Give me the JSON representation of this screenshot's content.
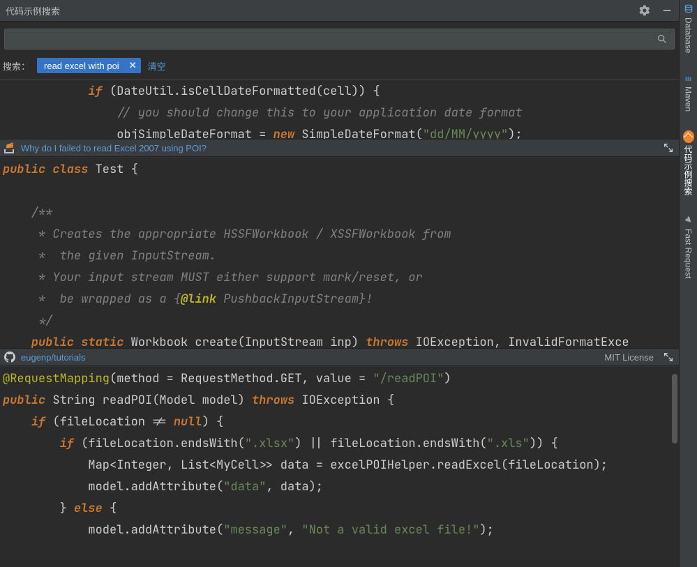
{
  "titlebar": {
    "title": "代码示例搜索"
  },
  "search": {
    "value": "",
    "placeholder": ""
  },
  "filter": {
    "label": "搜索：",
    "chip_text": "read excel with poi",
    "chip_close": "✕",
    "clear": "清空"
  },
  "sidebar": {
    "items": [
      {
        "icon": "database",
        "label": "Database"
      },
      {
        "icon": "maven",
        "label": "Maven"
      },
      {
        "icon": "code-search",
        "label": "代码示例搜索"
      },
      {
        "icon": "rocket",
        "label": "Fast Request"
      }
    ]
  },
  "result_headers": {
    "so": {
      "title": "Why do I failed to read Excel 2007 using POI?"
    },
    "gh": {
      "repo": "eugenp/tutorials",
      "license": "MIT License"
    }
  },
  "code": {
    "top": [
      {
        "indent": "            ",
        "tokens": [
          {
            "t": "if",
            "c": "kw"
          },
          {
            "t": " (DateUtil.isCellDateFormatted(cell)) {"
          }
        ]
      },
      {
        "indent": "                ",
        "tokens": [
          {
            "t": "// you should change this to your application date format",
            "c": "cm"
          }
        ]
      },
      {
        "indent": "                ",
        "tokens": [
          {
            "t": "objSimpleDateFormat = "
          },
          {
            "t": "new",
            "c": "kw"
          },
          {
            "t": " SimpleDateFormat("
          },
          {
            "t": "\"dd/MM/yyyy\"",
            "c": "st"
          },
          {
            "t": ");"
          }
        ]
      }
    ],
    "mid": [
      {
        "indent": "",
        "tokens": [
          {
            "t": "public",
            "c": "kw"
          },
          {
            "t": " "
          },
          {
            "t": "class",
            "c": "kw"
          },
          {
            "t": " Test {"
          }
        ]
      },
      {
        "indent": "",
        "tokens": [
          {
            "t": " "
          }
        ]
      },
      {
        "indent": "    ",
        "tokens": [
          {
            "t": "/**",
            "c": "cm"
          }
        ]
      },
      {
        "indent": "    ",
        "tokens": [
          {
            "t": " * Creates the appropriate HSSFWorkbook / XSSFWorkbook from",
            "c": "cm"
          }
        ]
      },
      {
        "indent": "    ",
        "tokens": [
          {
            "t": " *  the given InputStream.",
            "c": "cm"
          }
        ]
      },
      {
        "indent": "    ",
        "tokens": [
          {
            "t": " * Your input stream MUST either support mark/reset, or",
            "c": "cm"
          }
        ]
      },
      {
        "indent": "    ",
        "tokens": [
          {
            "t": " *  be wrapped as a {",
            "c": "cm"
          },
          {
            "t": "@link",
            "c": "tg"
          },
          {
            "t": " PushbackInputStream}!",
            "c": "cm"
          }
        ]
      },
      {
        "indent": "    ",
        "tokens": [
          {
            "t": " */",
            "c": "cm"
          }
        ]
      },
      {
        "indent": "    ",
        "tokens": [
          {
            "t": "public",
            "c": "kw"
          },
          {
            "t": " "
          },
          {
            "t": "static",
            "c": "kw"
          },
          {
            "t": " Workbook create(InputStream inp) "
          },
          {
            "t": "throws",
            "c": "kw"
          },
          {
            "t": " IOException, InvalidFormatExce"
          }
        ]
      }
    ],
    "bot": [
      {
        "indent": "",
        "tokens": [
          {
            "t": "@RequestMapping",
            "c": "an"
          },
          {
            "t": "(method = RequestMethod.GET, value = "
          },
          {
            "t": "\"/readPOI\"",
            "c": "st"
          },
          {
            "t": ")"
          }
        ]
      },
      {
        "indent": "",
        "tokens": [
          {
            "t": "public",
            "c": "kw"
          },
          {
            "t": " String readPOI(Model model) "
          },
          {
            "t": "throws",
            "c": "kw"
          },
          {
            "t": " IOException {"
          }
        ]
      },
      {
        "indent": "    ",
        "tokens": [
          {
            "t": "if",
            "c": "kw"
          },
          {
            "t": " (fileLocation != "
          },
          {
            "t": "null",
            "c": "kw"
          },
          {
            "t": ") {"
          }
        ]
      },
      {
        "indent": "        ",
        "tokens": [
          {
            "t": "if",
            "c": "kw"
          },
          {
            "t": " (fileLocation.endsWith("
          },
          {
            "t": "\".xlsx\"",
            "c": "st"
          },
          {
            "t": ") || fileLocation.endsWith("
          },
          {
            "t": "\".xls\"",
            "c": "st"
          },
          {
            "t": ")) {"
          }
        ]
      },
      {
        "indent": "            ",
        "tokens": [
          {
            "t": "Map<Integer, List<MyCell>> data = excelPOIHelper.readExcel(fileLocation);"
          }
        ]
      },
      {
        "indent": "            ",
        "tokens": [
          {
            "t": "model.addAttribute("
          },
          {
            "t": "\"data\"",
            "c": "st"
          },
          {
            "t": ", data);"
          }
        ]
      },
      {
        "indent": "        ",
        "tokens": [
          {
            "t": "} "
          },
          {
            "t": "else",
            "c": "kw"
          },
          {
            "t": " {"
          }
        ]
      },
      {
        "indent": "            ",
        "tokens": [
          {
            "t": "model.addAttribute("
          },
          {
            "t": "\"message\"",
            "c": "st"
          },
          {
            "t": ", "
          },
          {
            "t": "\"Not a valid excel file!\"",
            "c": "st"
          },
          {
            "t": ");"
          }
        ]
      }
    ]
  }
}
